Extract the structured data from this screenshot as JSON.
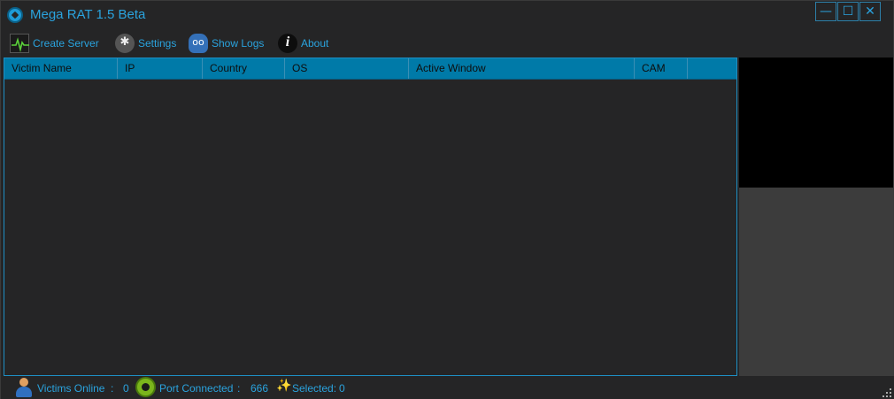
{
  "window": {
    "title": "Mega RAT 1.5 Beta",
    "icon": "app-logo-icon",
    "controls": {
      "minimize": "—",
      "maximize": "☐",
      "close": "✕"
    }
  },
  "toolbar": {
    "items": [
      {
        "label": "Create Server",
        "icon": "pulse-monitor-icon"
      },
      {
        "label": "Settings",
        "icon": "wrench-gear-icon"
      },
      {
        "label": "Show Logs",
        "icon": "voicemail-cloud-icon"
      },
      {
        "label": "About",
        "icon": "info-icon"
      }
    ]
  },
  "victims_table": {
    "columns": [
      "Victim Name",
      "IP",
      "Country",
      "OS",
      "Active Window",
      "CAM"
    ],
    "rows": []
  },
  "statusbar": {
    "victims_online_label": "Victims Online",
    "victims_online_sep": ":",
    "victims_online_value": "0",
    "port_label": "Port Connected",
    "port_sep": ":",
    "port_value": "666",
    "selected_label": "Selected:",
    "selected_value": "0"
  },
  "colors": {
    "accent": "#1e9bd7",
    "header_bg": "#007aa8",
    "background": "#252526",
    "preview_bg": "#000000"
  }
}
